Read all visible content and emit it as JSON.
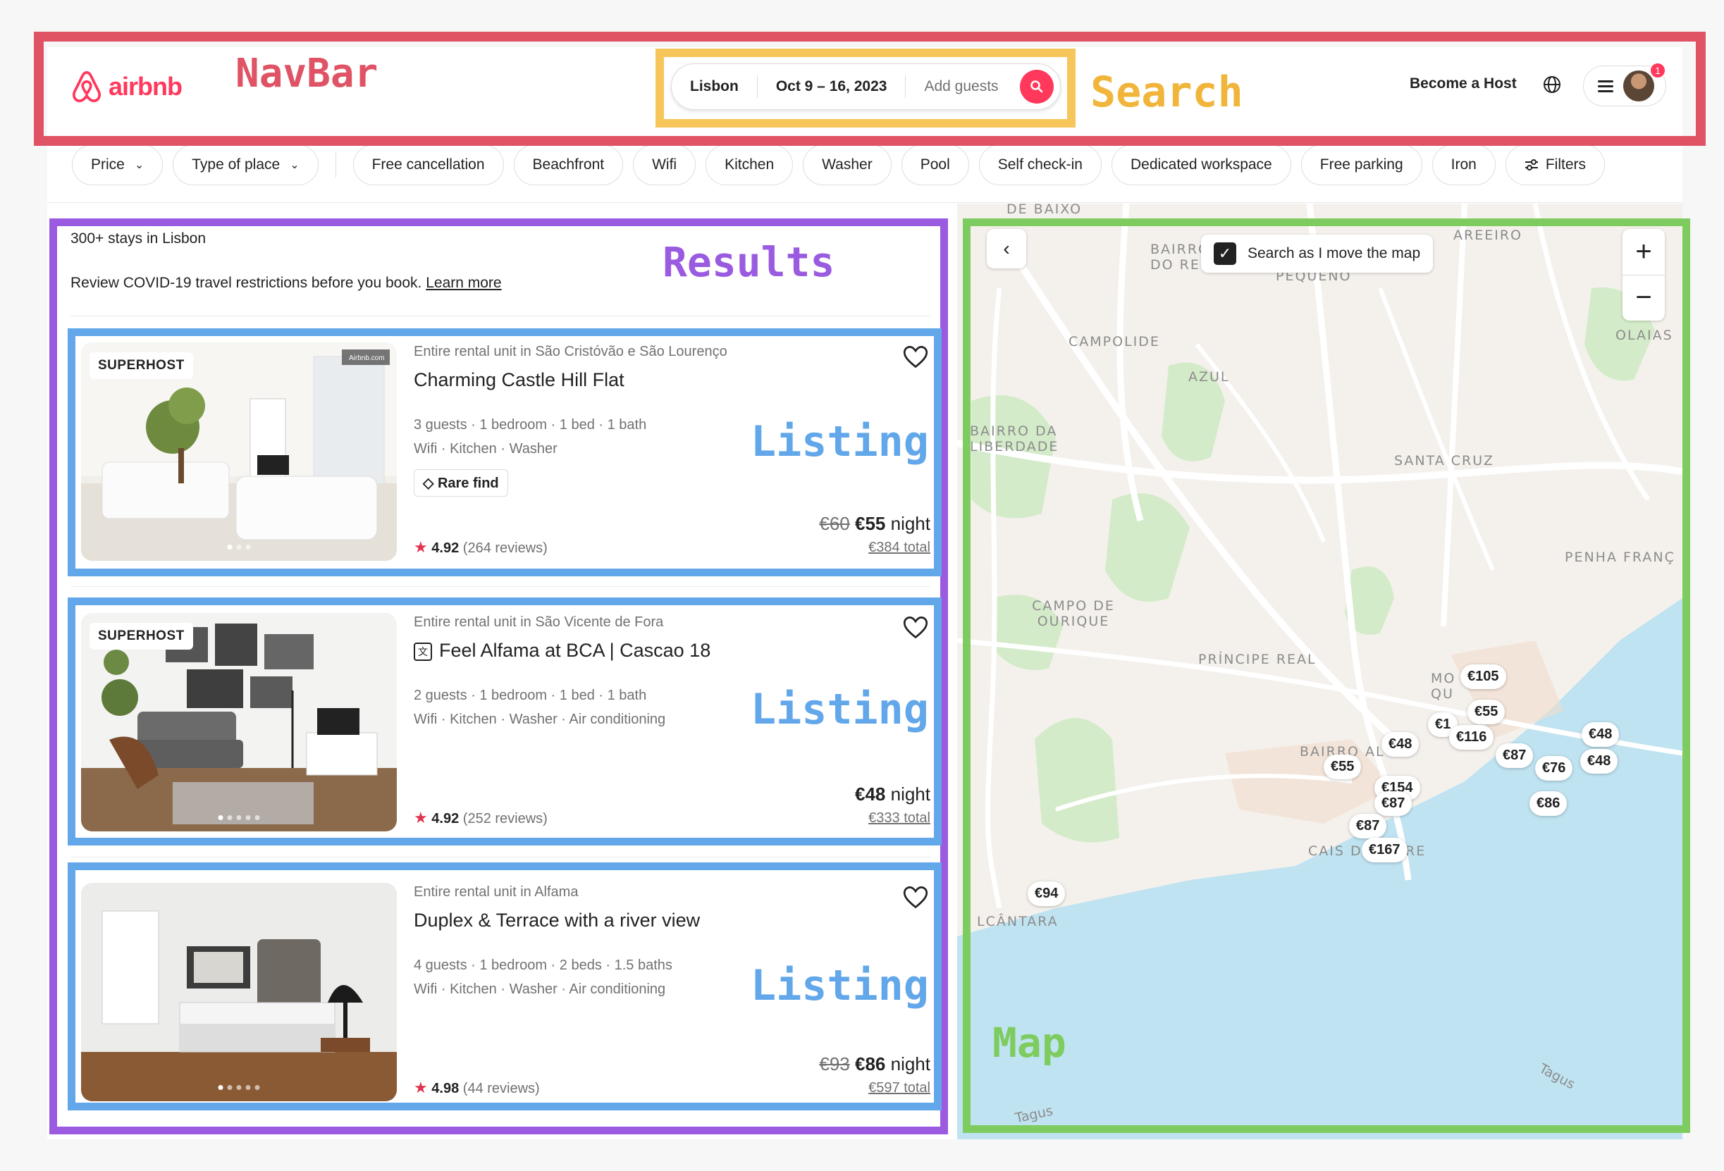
{
  "annotations": {
    "navbar": "NavBar",
    "search": "Search",
    "results": "Results",
    "listing": "Listing",
    "map": "Map"
  },
  "navbar": {
    "brand": "airbnb",
    "search": {
      "location": "Lisbon",
      "dates": "Oct 9 – 16, 2023",
      "guests_placeholder": "Add guests"
    },
    "become_host": "Become a Host",
    "notification_count": "1"
  },
  "filters": {
    "dropdowns": [
      "Price",
      "Type of place"
    ],
    "chips": [
      "Free cancellation",
      "Beachfront",
      "Wifi",
      "Kitchen",
      "Washer",
      "Pool",
      "Self check-in",
      "Dedicated workspace",
      "Free parking",
      "Iron"
    ],
    "filters_button": "Filters"
  },
  "results": {
    "count": "300+ stays in Lisbon",
    "covid_text": "Review COVID-19 travel restrictions before you book.",
    "covid_link": "Learn more",
    "listings": [
      {
        "badge": "SUPERHOST",
        "type": "Entire rental unit in São Cristóvão e São Lourenço",
        "title": "Charming Castle Hill Flat",
        "specs": "3 guests · 1 bedroom · 1 bed · 1 bath",
        "amenities": "Wifi · Kitchen · Washer",
        "tag": "Rare find",
        "old_price": "€60",
        "price": "€55",
        "unit": "night",
        "total": "€384 total",
        "rating": "4.92",
        "reviews": "(264 reviews)",
        "watermark": "Airbnb.com"
      },
      {
        "badge": "SUPERHOST",
        "type": "Entire rental unit in São Vicente de Fora",
        "title": "Feel Alfama at BCA | Cascao 18",
        "specs": "2 guests · 1 bedroom · 1 bed · 1 bath",
        "amenities": "Wifi · Kitchen · Washer · Air conditioning",
        "price": "€48",
        "unit": "night",
        "total": "€333 total",
        "rating": "4.92",
        "reviews": "(252 reviews)"
      },
      {
        "type": "Entire rental unit in Alfama",
        "title": "Duplex & Terrace with a river view",
        "specs": "4 guests · 1 bedroom · 2 beds · 1.5 baths",
        "amenities": "Wifi · Kitchen · Washer · Air conditioning",
        "old_price": "€93",
        "price": "€86",
        "unit": "night",
        "total": "€597 total",
        "rating": "4.98",
        "reviews": "(44 reviews)"
      }
    ]
  },
  "map": {
    "search_toggle": "Search as I move the map",
    "zoom_in": "+",
    "zoom_out": "−",
    "areas": [
      "DE BAIXO",
      "AREEIRO",
      "BAIRRO DO REGO",
      "PEQUENO",
      "CAMPOLIDE",
      "AZUL",
      "OLAIAS",
      "BAIRRO DA LIBERDADE",
      "SANTA CRUZ",
      "PENHA FRANÇ",
      "CAMPO DE OURIQUE",
      "PRÍNCIPE REAL",
      "MO QU",
      "BAIRRO AL",
      "CAIS D",
      "RE",
      "LCÂNTARA",
      "Tagus",
      "Tagus"
    ],
    "pins": [
      "€105",
      "€55",
      "€1",
      "€116",
      "€48",
      "€87",
      "€48",
      "€76",
      "€48",
      "€55",
      "€154",
      "€87",
      "€86",
      "€87",
      "€167",
      "€94"
    ],
    "colors": {
      "water": "#bfe3f1",
      "park": "#d4ebc9",
      "land": "#f4f1ec",
      "road": "#ffffff"
    }
  }
}
